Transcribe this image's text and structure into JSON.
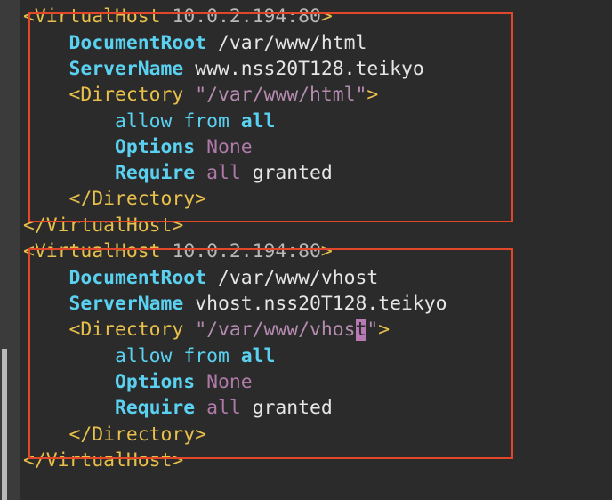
{
  "vhosts": [
    {
      "open_tag": "<VirtualHost",
      "address": "10.0.2.194:80",
      "open_close": ">",
      "docroot_key": "DocumentRoot",
      "docroot_val": "/var/www/html",
      "servername_key": "ServerName",
      "servername_val": "www.nss20T128.teikyo",
      "dir_open": "<Directory",
      "dir_path": "\"/var/www/html\"",
      "dir_path_pre": "\"/var/www/html",
      "dir_path_cursor": "",
      "dir_path_post": "\"",
      "dir_close_bracket": ">",
      "allow_kw": "allow",
      "allow_from": "from",
      "allow_all": "all",
      "options_key": "Options",
      "options_val": "None",
      "require_key": "Require",
      "require_all": "all",
      "require_val": "granted",
      "dir_end": "</Directory>",
      "vh_end": "</VirtualHost>"
    },
    {
      "open_tag": "<VirtualHost",
      "address": "10.0.2.194:80",
      "open_close": ">",
      "docroot_key": "DocumentRoot",
      "docroot_val": "/var/www/vhost",
      "servername_key": "ServerName",
      "servername_val": "vhost.nss20T128.teikyo",
      "dir_open": "<Directory",
      "dir_path_pre": "\"/var/www/vhos",
      "dir_path_cursor": "t",
      "dir_path_post": "\"",
      "dir_close_bracket": ">",
      "allow_kw": "allow",
      "allow_from": "from",
      "allow_all": "all",
      "options_key": "Options",
      "options_val": "None",
      "require_key": "Require",
      "require_all": "all",
      "require_val": "granted",
      "dir_end": "</Directory>",
      "vh_end": "</VirtualHost>"
    }
  ],
  "colors": {
    "background": "#2b2b2b",
    "tag": "#e8c04a",
    "directive": "#5ad1f0",
    "string": "#b58bb0",
    "highlight_box": "#e2472a",
    "cursor": "#b87ab2"
  }
}
